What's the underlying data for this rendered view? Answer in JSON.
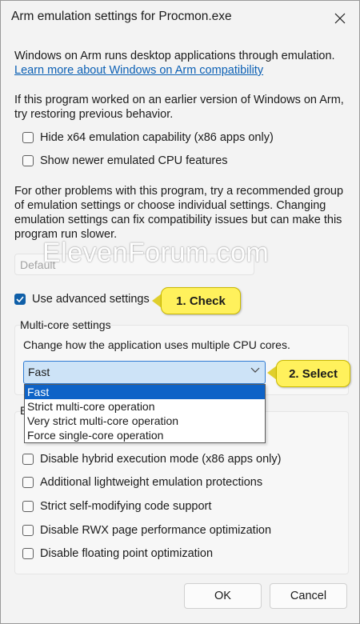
{
  "window": {
    "title": "Arm emulation settings for Procmon.exe"
  },
  "intro": {
    "text": "Windows on Arm runs desktop applications through emulation. ",
    "link": "Learn more about Windows on Arm compatibility"
  },
  "restore": {
    "text": "If this program worked on an earlier version of Windows on Arm, try restoring previous behavior.",
    "options": [
      {
        "label": "Hide x64 emulation capability (x86 apps only)",
        "checked": false
      },
      {
        "label": "Show newer emulated CPU features",
        "checked": false
      }
    ]
  },
  "other": {
    "text": "For other problems with this program, try a recommended group of emulation settings or choose individual settings. Changing emulation settings can fix compatibility issues but can make this program run slower."
  },
  "preset": {
    "value": "Default"
  },
  "watermark": "ElevenForum.com",
  "advanced": {
    "label": "Use advanced settings",
    "checked": true
  },
  "callouts": {
    "check": "1. Check",
    "select": "2. Select"
  },
  "multicore": {
    "title": "Multi-core settings",
    "description": "Change how the application uses multiple CPU cores.",
    "selected": "Fast",
    "options": [
      "Fast",
      "Strict multi-core operation",
      "Very strict multi-core operation",
      "Force single-core operation"
    ]
  },
  "second_group": {
    "title_visible": "E",
    "options": [
      {
        "label": "Disable hybrid execution mode (x86 apps only)",
        "checked": false
      },
      {
        "label": "Additional lightweight emulation protections",
        "checked": false
      },
      {
        "label": "Strict self-modifying code support",
        "checked": false
      },
      {
        "label": "Disable RWX page performance optimization",
        "checked": false
      },
      {
        "label": "Disable floating point optimization",
        "checked": false
      }
    ]
  },
  "buttons": {
    "ok": "OK",
    "cancel": "Cancel"
  },
  "colors": {
    "accent": "#0e63c7",
    "callout": "#fff15c",
    "link": "#0a5fb4"
  }
}
